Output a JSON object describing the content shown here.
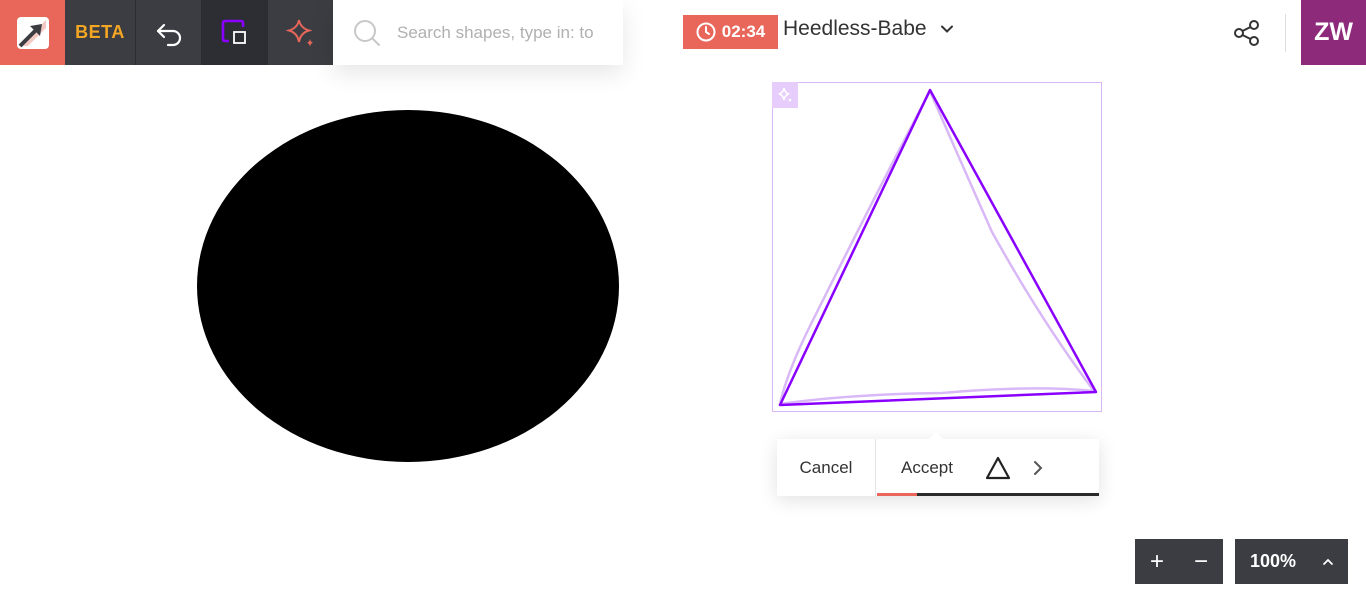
{
  "toolbar": {
    "beta_label": "BETA",
    "tools": [
      {
        "name": "undo-icon"
      },
      {
        "name": "shape-select-icon"
      },
      {
        "name": "magic-sparkle-icon"
      }
    ]
  },
  "search": {
    "placeholder": "Search shapes, type in: to"
  },
  "header": {
    "timer": "02:34",
    "doc_name": "Heedless-Babe"
  },
  "user": {
    "initials": "ZW"
  },
  "suggestion": {
    "cancel_label": "Cancel",
    "accept_label": "Accept",
    "progress": 0.18
  },
  "zoom": {
    "level": "100%",
    "in_label": "+",
    "out_label": "−"
  },
  "colors": {
    "accent": "#e8665a",
    "toolbar_bg": "#3b3d42",
    "beta": "#f5a623",
    "avatar_bg": "#8e2a7a",
    "selection": "#8a00ff",
    "selection_light": "#d9b8f7"
  }
}
